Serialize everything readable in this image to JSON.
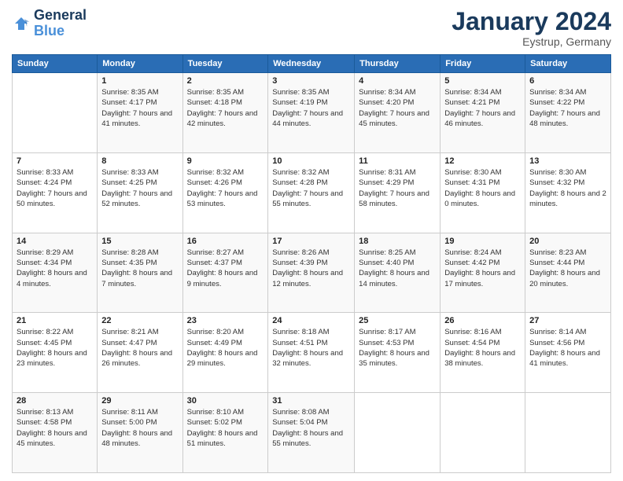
{
  "logo": {
    "line1": "General",
    "line2": "Blue"
  },
  "title": "January 2024",
  "location": "Eystrup, Germany",
  "days_of_week": [
    "Sunday",
    "Monday",
    "Tuesday",
    "Wednesday",
    "Thursday",
    "Friday",
    "Saturday"
  ],
  "weeks": [
    [
      {
        "day": "",
        "sunrise": "",
        "sunset": "",
        "daylight": ""
      },
      {
        "day": "1",
        "sunrise": "Sunrise: 8:35 AM",
        "sunset": "Sunset: 4:17 PM",
        "daylight": "Daylight: 7 hours and 41 minutes."
      },
      {
        "day": "2",
        "sunrise": "Sunrise: 8:35 AM",
        "sunset": "Sunset: 4:18 PM",
        "daylight": "Daylight: 7 hours and 42 minutes."
      },
      {
        "day": "3",
        "sunrise": "Sunrise: 8:35 AM",
        "sunset": "Sunset: 4:19 PM",
        "daylight": "Daylight: 7 hours and 44 minutes."
      },
      {
        "day": "4",
        "sunrise": "Sunrise: 8:34 AM",
        "sunset": "Sunset: 4:20 PM",
        "daylight": "Daylight: 7 hours and 45 minutes."
      },
      {
        "day": "5",
        "sunrise": "Sunrise: 8:34 AM",
        "sunset": "Sunset: 4:21 PM",
        "daylight": "Daylight: 7 hours and 46 minutes."
      },
      {
        "day": "6",
        "sunrise": "Sunrise: 8:34 AM",
        "sunset": "Sunset: 4:22 PM",
        "daylight": "Daylight: 7 hours and 48 minutes."
      }
    ],
    [
      {
        "day": "7",
        "sunrise": "Sunrise: 8:33 AM",
        "sunset": "Sunset: 4:24 PM",
        "daylight": "Daylight: 7 hours and 50 minutes."
      },
      {
        "day": "8",
        "sunrise": "Sunrise: 8:33 AM",
        "sunset": "Sunset: 4:25 PM",
        "daylight": "Daylight: 7 hours and 52 minutes."
      },
      {
        "day": "9",
        "sunrise": "Sunrise: 8:32 AM",
        "sunset": "Sunset: 4:26 PM",
        "daylight": "Daylight: 7 hours and 53 minutes."
      },
      {
        "day": "10",
        "sunrise": "Sunrise: 8:32 AM",
        "sunset": "Sunset: 4:28 PM",
        "daylight": "Daylight: 7 hours and 55 minutes."
      },
      {
        "day": "11",
        "sunrise": "Sunrise: 8:31 AM",
        "sunset": "Sunset: 4:29 PM",
        "daylight": "Daylight: 7 hours and 58 minutes."
      },
      {
        "day": "12",
        "sunrise": "Sunrise: 8:30 AM",
        "sunset": "Sunset: 4:31 PM",
        "daylight": "Daylight: 8 hours and 0 minutes."
      },
      {
        "day": "13",
        "sunrise": "Sunrise: 8:30 AM",
        "sunset": "Sunset: 4:32 PM",
        "daylight": "Daylight: 8 hours and 2 minutes."
      }
    ],
    [
      {
        "day": "14",
        "sunrise": "Sunrise: 8:29 AM",
        "sunset": "Sunset: 4:34 PM",
        "daylight": "Daylight: 8 hours and 4 minutes."
      },
      {
        "day": "15",
        "sunrise": "Sunrise: 8:28 AM",
        "sunset": "Sunset: 4:35 PM",
        "daylight": "Daylight: 8 hours and 7 minutes."
      },
      {
        "day": "16",
        "sunrise": "Sunrise: 8:27 AM",
        "sunset": "Sunset: 4:37 PM",
        "daylight": "Daylight: 8 hours and 9 minutes."
      },
      {
        "day": "17",
        "sunrise": "Sunrise: 8:26 AM",
        "sunset": "Sunset: 4:39 PM",
        "daylight": "Daylight: 8 hours and 12 minutes."
      },
      {
        "day": "18",
        "sunrise": "Sunrise: 8:25 AM",
        "sunset": "Sunset: 4:40 PM",
        "daylight": "Daylight: 8 hours and 14 minutes."
      },
      {
        "day": "19",
        "sunrise": "Sunrise: 8:24 AM",
        "sunset": "Sunset: 4:42 PM",
        "daylight": "Daylight: 8 hours and 17 minutes."
      },
      {
        "day": "20",
        "sunrise": "Sunrise: 8:23 AM",
        "sunset": "Sunset: 4:44 PM",
        "daylight": "Daylight: 8 hours and 20 minutes."
      }
    ],
    [
      {
        "day": "21",
        "sunrise": "Sunrise: 8:22 AM",
        "sunset": "Sunset: 4:45 PM",
        "daylight": "Daylight: 8 hours and 23 minutes."
      },
      {
        "day": "22",
        "sunrise": "Sunrise: 8:21 AM",
        "sunset": "Sunset: 4:47 PM",
        "daylight": "Daylight: 8 hours and 26 minutes."
      },
      {
        "day": "23",
        "sunrise": "Sunrise: 8:20 AM",
        "sunset": "Sunset: 4:49 PM",
        "daylight": "Daylight: 8 hours and 29 minutes."
      },
      {
        "day": "24",
        "sunrise": "Sunrise: 8:18 AM",
        "sunset": "Sunset: 4:51 PM",
        "daylight": "Daylight: 8 hours and 32 minutes."
      },
      {
        "day": "25",
        "sunrise": "Sunrise: 8:17 AM",
        "sunset": "Sunset: 4:53 PM",
        "daylight": "Daylight: 8 hours and 35 minutes."
      },
      {
        "day": "26",
        "sunrise": "Sunrise: 8:16 AM",
        "sunset": "Sunset: 4:54 PM",
        "daylight": "Daylight: 8 hours and 38 minutes."
      },
      {
        "day": "27",
        "sunrise": "Sunrise: 8:14 AM",
        "sunset": "Sunset: 4:56 PM",
        "daylight": "Daylight: 8 hours and 41 minutes."
      }
    ],
    [
      {
        "day": "28",
        "sunrise": "Sunrise: 8:13 AM",
        "sunset": "Sunset: 4:58 PM",
        "daylight": "Daylight: 8 hours and 45 minutes."
      },
      {
        "day": "29",
        "sunrise": "Sunrise: 8:11 AM",
        "sunset": "Sunset: 5:00 PM",
        "daylight": "Daylight: 8 hours and 48 minutes."
      },
      {
        "day": "30",
        "sunrise": "Sunrise: 8:10 AM",
        "sunset": "Sunset: 5:02 PM",
        "daylight": "Daylight: 8 hours and 51 minutes."
      },
      {
        "day": "31",
        "sunrise": "Sunrise: 8:08 AM",
        "sunset": "Sunset: 5:04 PM",
        "daylight": "Daylight: 8 hours and 55 minutes."
      },
      {
        "day": "",
        "sunrise": "",
        "sunset": "",
        "daylight": ""
      },
      {
        "day": "",
        "sunrise": "",
        "sunset": "",
        "daylight": ""
      },
      {
        "day": "",
        "sunrise": "",
        "sunset": "",
        "daylight": ""
      }
    ]
  ]
}
